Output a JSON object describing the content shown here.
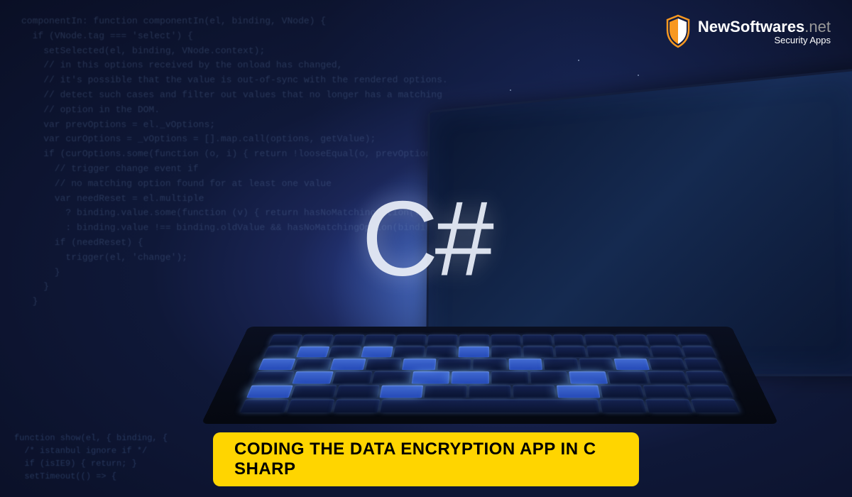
{
  "brand": {
    "name": "NewSoftwares",
    "domain": ".net",
    "tagline": "Security Apps"
  },
  "center_logo": "C#",
  "banner": {
    "text": "CODING THE DATA ENCRYPTION APP IN C SHARP"
  },
  "code_background": {
    "top": "componentIn: function componentIn(el, binding, VNode) {\n  if (VNode.tag === 'select') {\n    setSelected(el, binding, VNode.context);\n    // in this options received by the onload has changed,\n    // it's possible that the value is out-of-sync with the rendered options.\n    // detect such cases and filter out values that no longer has a matching\n    // option in the DOM.\n    var prevOptions = el._vOptions;\n    var curOptions = _vOptions = [].map.call(options, getValue);\n    if (curOptions.some(function (o, i) { return !looseEqual(o, prevOptions[i]); })) {\n      // trigger change event if\n      // no matching option found for at least one value\n      var needReset = el.multiple\n        ? binding.value.some(function (v) { return hasNoMatchingOption(v, curOptions); })\n        : binding.value !== binding.oldValue && hasNoMatchingOption(binding.value, curOptions);\n      if (needReset) {\n        trigger(el, 'change');\n      }\n    }\n  }",
    "bottom": "function show(el, { binding, {\n  /* istanbul ignore if */\n  if (isIE9) { return; }\n  setTimeout(() => {"
  },
  "colors": {
    "banner_bg": "#ffd500",
    "banner_text": "#000000",
    "logo_text": "#ffffff",
    "logo_accent": "#f89820"
  }
}
